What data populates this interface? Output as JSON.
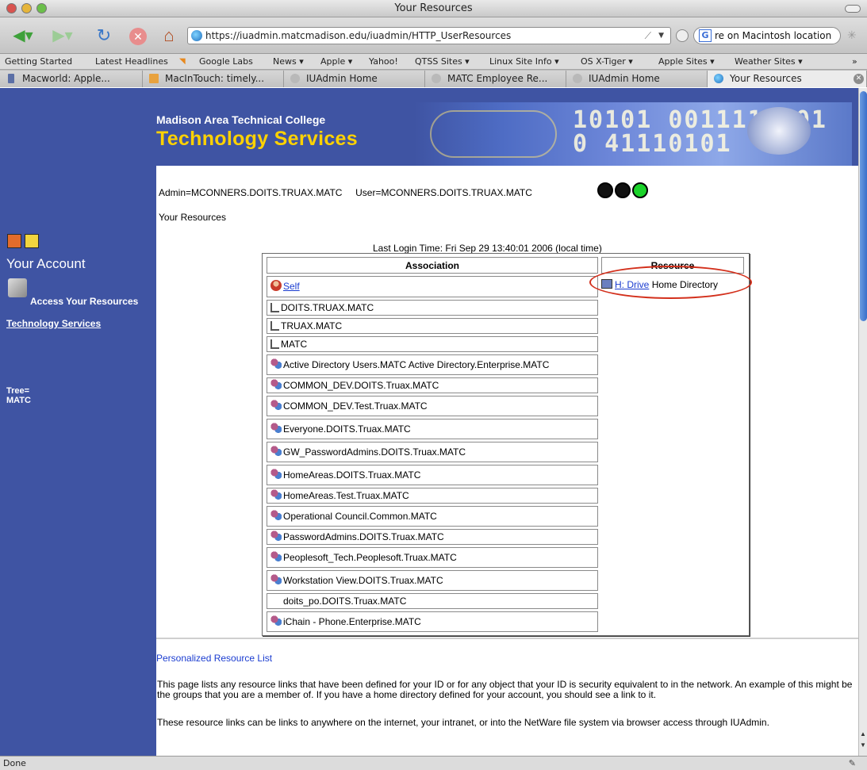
{
  "window": {
    "title": "Your Resources"
  },
  "toolbar": {
    "url": "https://iuadmin.matcmadison.edu/iuadmin/HTTP_UserResources",
    "search_text": "re on Macintosh location",
    "search_engine_letter": "G"
  },
  "bookmarks": [
    "Getting Started",
    "Latest Headlines",
    "Google Labs",
    "News ▾",
    "Apple ▾",
    "Yahoo!",
    "QTSS Sites ▾",
    "Linux Site Info ▾",
    "OS X-Tiger ▾",
    "Apple Sites ▾",
    "Weather Sites ▾"
  ],
  "tabs": [
    "Macworld: Apple...",
    "MacInTouch: timely...",
    "IUAdmin Home",
    "MATC Employee Re...",
    "IUAdmin Home",
    "Your Resources"
  ],
  "banner": {
    "college": "Madison Area Technical College",
    "dept": "Technology Services",
    "bits": "10101 0011110101 0 41110101"
  },
  "page": {
    "user_line": "Admin=MCONNERS.DOITS.TRUAX.MATC     User=MCONNERS.DOITS.TRUAX.MATC",
    "your_resources": "Your Resources",
    "last_login": "Last Login Time: Fri Sep 29 13:40:01 2006 (local time)"
  },
  "sidebar": {
    "title": "Your Account",
    "access": "Access Your Resources",
    "tech_link": "Technology Services",
    "tree_label": "Tree=",
    "tree_value": "MATC"
  },
  "table": {
    "headers": [
      "Association",
      "Resource"
    ],
    "rows": [
      {
        "icon": "user-icon",
        "text": "Self",
        "link": true
      },
      {
        "icon": "org-icon",
        "text": "DOITS.TRUAX.MATC"
      },
      {
        "icon": "org-icon",
        "text": "TRUAX.MATC"
      },
      {
        "icon": "org-icon",
        "text": "MATC"
      },
      {
        "icon": "group-icon",
        "text": "Active Directory Users.MATC Active Directory.Enterprise.MATC"
      },
      {
        "icon": "group-icon",
        "text": "COMMON_DEV.DOITS.Truax.MATC"
      },
      {
        "icon": "group-icon",
        "text": "COMMON_DEV.Test.Truax.MATC"
      },
      {
        "icon": "group-icon",
        "text": "Everyone.DOITS.Truax.MATC"
      },
      {
        "icon": "group-icon",
        "text": "GW_PasswordAdmins.DOITS.Truax.MATC"
      },
      {
        "icon": "group-icon",
        "text": "HomeAreas.DOITS.Truax.MATC"
      },
      {
        "icon": "group-icon",
        "text": "HomeAreas.Test.Truax.MATC"
      },
      {
        "icon": "group-icon",
        "text": "Operational Council.Common.MATC"
      },
      {
        "icon": "group-icon",
        "text": "PasswordAdmins.DOITS.Truax.MATC"
      },
      {
        "icon": "group-icon",
        "text": "Peoplesoft_Tech.Peoplesoft.Truax.MATC"
      },
      {
        "icon": "group-icon",
        "text": "Workstation View.DOITS.Truax.MATC"
      },
      {
        "icon": "",
        "text": "doits_po.DOITS.Truax.MATC"
      },
      {
        "icon": "group-icon",
        "text": "iChain - Phone.Enterprise.MATC"
      }
    ],
    "resource_link": "H: Drive",
    "resource_desc": "Home Directory"
  },
  "footer": {
    "link": "Personalized Resource List",
    "para1": "This page lists any resource links that have been defined for your ID or for any object that your ID is security equivalent to in the network. An example of this might be the groups that you are a member of. If you have a home directory defined for your account, you should see a link to it.",
    "para2": "These resource links can be links to anywhere on the internet, your intranet, or into the NetWare file system via browser access through IUAdmin."
  },
  "status": {
    "text": "Done"
  }
}
